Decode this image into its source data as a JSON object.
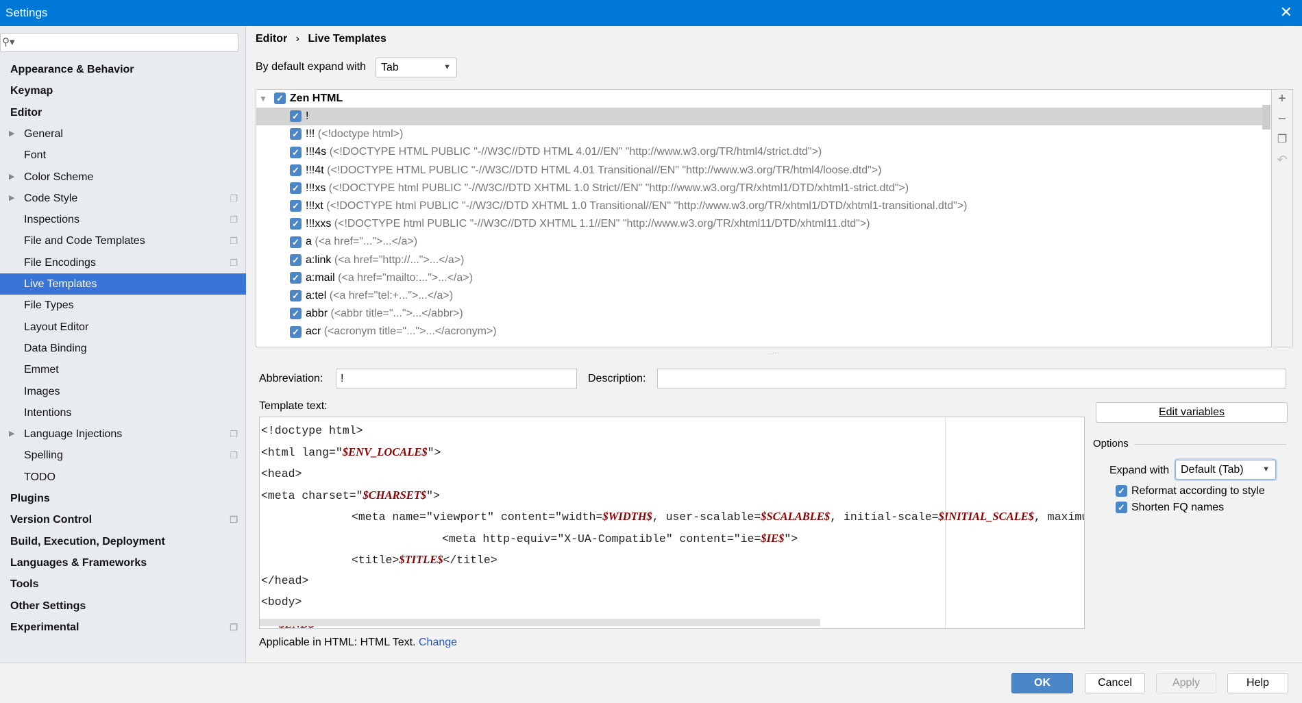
{
  "window": {
    "title": "Settings",
    "close_icon": "close-icon"
  },
  "sidebar": {
    "search_placeholder": "",
    "items": [
      {
        "label": "Appearance & Behavior",
        "level": 0,
        "arrow": "right"
      },
      {
        "label": "Keymap",
        "level": 0
      },
      {
        "label": "Editor",
        "level": 0,
        "arrow": "down"
      },
      {
        "label": "General",
        "level": 1,
        "arrow": "right"
      },
      {
        "label": "Font",
        "level": 1
      },
      {
        "label": "Color Scheme",
        "level": 1,
        "arrow": "right"
      },
      {
        "label": "Code Style",
        "level": 1,
        "arrow": "right",
        "copy": true
      },
      {
        "label": "Inspections",
        "level": 1,
        "copy": true
      },
      {
        "label": "File and Code Templates",
        "level": 1,
        "copy": true
      },
      {
        "label": "File Encodings",
        "level": 1,
        "copy": true
      },
      {
        "label": "Live Templates",
        "level": 1,
        "selected": true
      },
      {
        "label": "File Types",
        "level": 1
      },
      {
        "label": "Layout Editor",
        "level": 1
      },
      {
        "label": "Data Binding",
        "level": 1
      },
      {
        "label": "Emmet",
        "level": 1
      },
      {
        "label": "Images",
        "level": 1
      },
      {
        "label": "Intentions",
        "level": 1
      },
      {
        "label": "Language Injections",
        "level": 1,
        "arrow": "right",
        "copy": true
      },
      {
        "label": "Spelling",
        "level": 1,
        "copy": true
      },
      {
        "label": "TODO",
        "level": 1
      },
      {
        "label": "Plugins",
        "level": 0
      },
      {
        "label": "Version Control",
        "level": 0,
        "arrow": "right",
        "copy": true
      },
      {
        "label": "Build, Execution, Deployment",
        "level": 0,
        "arrow": "right"
      },
      {
        "label": "Languages & Frameworks",
        "level": 0,
        "arrow": "right"
      },
      {
        "label": "Tools",
        "level": 0,
        "arrow": "right"
      },
      {
        "label": "Other Settings",
        "level": 0,
        "arrow": "right"
      },
      {
        "label": "Experimental",
        "level": 0,
        "copy": true
      }
    ]
  },
  "breadcrumb": {
    "parent": "Editor",
    "separator": "›",
    "current": "Live Templates"
  },
  "expand": {
    "label": "By default expand with",
    "value": "Tab"
  },
  "tree": {
    "group": "Zen HTML",
    "rows": [
      {
        "abbr": "!",
        "desc": "",
        "selected": true
      },
      {
        "abbr": "!!!",
        "desc": "(<!doctype html>)"
      },
      {
        "abbr": "!!!4s",
        "desc": "(<!DOCTYPE HTML PUBLIC \"-//W3C//DTD HTML 4.01//EN\" \"http://www.w3.org/TR/html4/strict.dtd\">)"
      },
      {
        "abbr": "!!!4t",
        "desc": "(<!DOCTYPE HTML PUBLIC \"-//W3C//DTD HTML 4.01 Transitional//EN\" \"http://www.w3.org/TR/html4/loose.dtd\">)"
      },
      {
        "abbr": "!!!xs",
        "desc": "(<!DOCTYPE html PUBLIC \"-//W3C//DTD XHTML 1.0 Strict//EN\" \"http://www.w3.org/TR/xhtml1/DTD/xhtml1-strict.dtd\">)"
      },
      {
        "abbr": "!!!xt",
        "desc": "(<!DOCTYPE html PUBLIC \"-//W3C//DTD XHTML 1.0 Transitional//EN\" \"http://www.w3.org/TR/xhtml1/DTD/xhtml1-transitional.dtd\">)"
      },
      {
        "abbr": "!!!xxs",
        "desc": "(<!DOCTYPE html PUBLIC \"-//W3C//DTD XHTML 1.1//EN\" \"http://www.w3.org/TR/xhtml11/DTD/xhtml11.dtd\">)"
      },
      {
        "abbr": "a",
        "desc": "(<a href=\"...\">...</a>)"
      },
      {
        "abbr": "a:link",
        "desc": "(<a href=\"http://...\">...</a>)"
      },
      {
        "abbr": "a:mail",
        "desc": "(<a href=\"mailto:...\">...</a>)"
      },
      {
        "abbr": "a:tel",
        "desc": "(<a href=\"tel:+...\">...</a>)"
      },
      {
        "abbr": "abbr",
        "desc": "(<abbr title=\"...\">...</abbr>)"
      },
      {
        "abbr": "acr",
        "desc": "(<acronym title=\"...\">...</acronym>)"
      }
    ]
  },
  "toolbar": {
    "add_icon": "plus-icon",
    "remove_icon": "minus-icon",
    "copy_icon": "copy-icon",
    "restore_icon": "undo-icon"
  },
  "form": {
    "abbreviation_label": "Abbreviation:",
    "abbreviation_value": "!",
    "description_label": "Description:",
    "description_value": "",
    "template_label": "Template text:"
  },
  "template_lines": [
    {
      "indent": 0,
      "parts": [
        {
          "t": "<!doctype html>"
        }
      ]
    },
    {
      "indent": 0,
      "parts": [
        {
          "t": "<html lang=\""
        },
        {
          "v": "$ENV_LOCALE$"
        },
        {
          "t": "\">"
        }
      ]
    },
    {
      "indent": 0,
      "parts": [
        {
          "t": "<head>"
        }
      ]
    },
    {
      "indent": 0,
      "parts": [
        {
          "t": "<meta charset=\""
        },
        {
          "v": "$CHARSET$"
        },
        {
          "t": "\">"
        }
      ]
    },
    {
      "indent": 1,
      "parts": [
        {
          "t": "<meta name=\"viewport\" content=\"width="
        },
        {
          "v": "$WIDTH$"
        },
        {
          "t": ", user-scalable="
        },
        {
          "v": "$SCALABLE$"
        },
        {
          "t": ", initial-scale="
        },
        {
          "v": "$INITIAL_SCALE$"
        },
        {
          "t": ", maximum-scale="
        }
      ]
    },
    {
      "indent": 2,
      "parts": [
        {
          "t": "<meta http-equiv=\"X-UA-Compatible\" content=\"ie="
        },
        {
          "v": "$IE$"
        },
        {
          "t": "\">"
        }
      ]
    },
    {
      "indent": 1,
      "parts": [
        {
          "t": "<title>"
        },
        {
          "v": "$TITLE$"
        },
        {
          "t": "</title>"
        }
      ]
    },
    {
      "indent": 0,
      "parts": [
        {
          "t": "</head>"
        }
      ]
    },
    {
      "indent": 0,
      "parts": [
        {
          "t": "<body>"
        }
      ]
    },
    {
      "indent": 0.2,
      "parts": [
        {
          "v": "$END$"
        }
      ]
    }
  ],
  "applicable": {
    "text": "Applicable in HTML: HTML Text.",
    "link": "Change"
  },
  "options": {
    "edit_variables": "Edit variables",
    "title": "Options",
    "expand_label": "Expand with",
    "expand_value": "Default (Tab)",
    "reformat": {
      "label": "Reformat according to style",
      "checked": true
    },
    "shorten": {
      "label": "Shorten FQ names",
      "checked": true
    }
  },
  "buttons": {
    "ok": "OK",
    "cancel": "Cancel",
    "apply": "Apply",
    "help": "Help"
  },
  "colors": {
    "titlebar": "#0078d7",
    "selection": "#3875d7",
    "checkbox": "#4a86c8",
    "variable": "#8b0000",
    "link": "#2255cc"
  }
}
